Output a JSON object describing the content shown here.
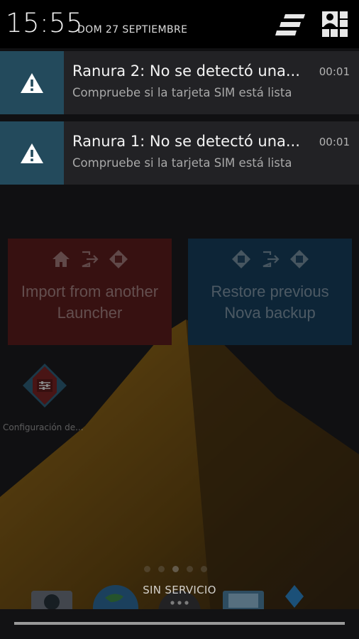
{
  "status": {
    "time": "15:55",
    "date": "DOM 27 SEPTIEMBRE"
  },
  "header_icons": {
    "settings_icon": "quick-settings-icon",
    "user_icon": "user-profile-icon"
  },
  "notifications": [
    {
      "icon": "warning-icon",
      "title": "Ranura 2: No se detectó una...",
      "text": "Compruebe si la tarjeta SIM está lista",
      "time": "00:01"
    },
    {
      "icon": "warning-icon",
      "title": "Ranura 1: No se detectó una...",
      "text": "Compruebe si la tarjeta SIM está lista",
      "time": "00:01"
    }
  ],
  "home": {
    "import_tile": {
      "label": "Import from another\nLauncher",
      "color": "#5c1d1d"
    },
    "restore_tile": {
      "label": "Restore previous\nNova backup",
      "color": "#163e5d"
    },
    "app": {
      "label": "Configuración de...",
      "icon": "nova-settings-icon"
    },
    "page_count": 5,
    "active_page": 3,
    "dock_icons": [
      "camera-icon",
      "browser-icon",
      "app-drawer-icon",
      "photo-icon",
      "store-icon"
    ]
  },
  "network": {
    "carrier_text": "SIN SERVICIO"
  },
  "colors": {
    "notification_bg": "#222225",
    "notification_icon_bg": "#234a5c",
    "header_bg": "#000000"
  }
}
